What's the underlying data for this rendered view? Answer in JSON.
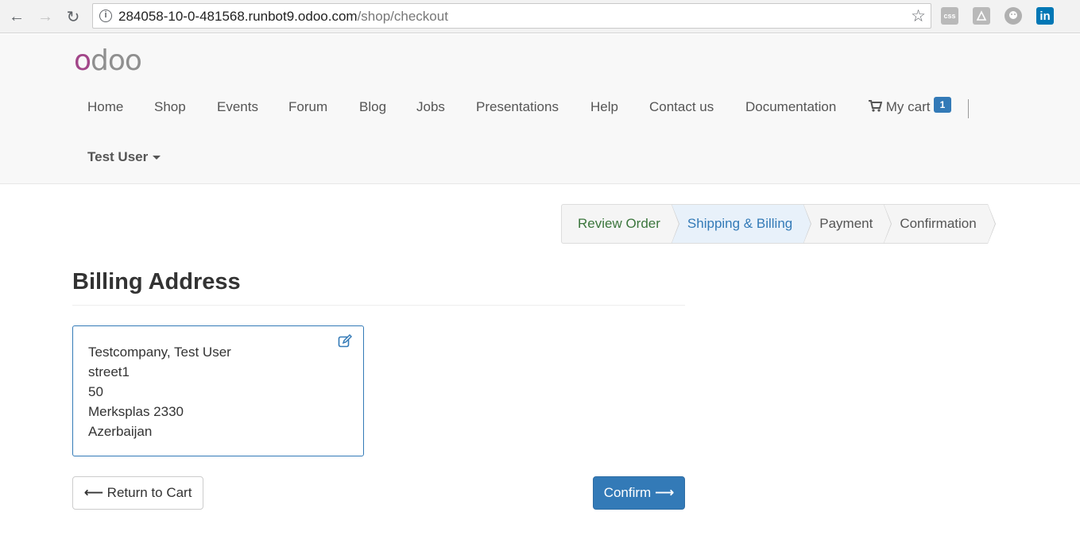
{
  "browser": {
    "url_host": "284058-10-0-481568.runbot9.odoo.com",
    "url_path": "/shop/checkout",
    "extensions": [
      "css-icon",
      "pdf-icon",
      "ghost-icon",
      "linkedin-icon"
    ],
    "linkedin_label": "in"
  },
  "site": {
    "logo": "odoo",
    "menu": [
      "Home",
      "Shop",
      "Events",
      "Forum",
      "Blog",
      "Jobs",
      "Presentations",
      "Help",
      "Contact us",
      "Documentation"
    ],
    "cart_label": "My cart",
    "cart_count": "1",
    "user_name": "Test User"
  },
  "wizard": {
    "steps": [
      "Review Order",
      "Shipping & Billing",
      "Payment",
      "Confirmation"
    ],
    "active_index": 1
  },
  "billing": {
    "title": "Billing Address",
    "lines": [
      "Testcompany, Test User",
      "street1",
      "50",
      "Merksplas 2330",
      "Azerbaijan"
    ]
  },
  "actions": {
    "return_label": "Return to Cart",
    "confirm_label": "Confirm"
  },
  "colors": {
    "brand_primary": "#337ab7",
    "logo_accent": "#a24689",
    "done_step": "#3c763d"
  }
}
